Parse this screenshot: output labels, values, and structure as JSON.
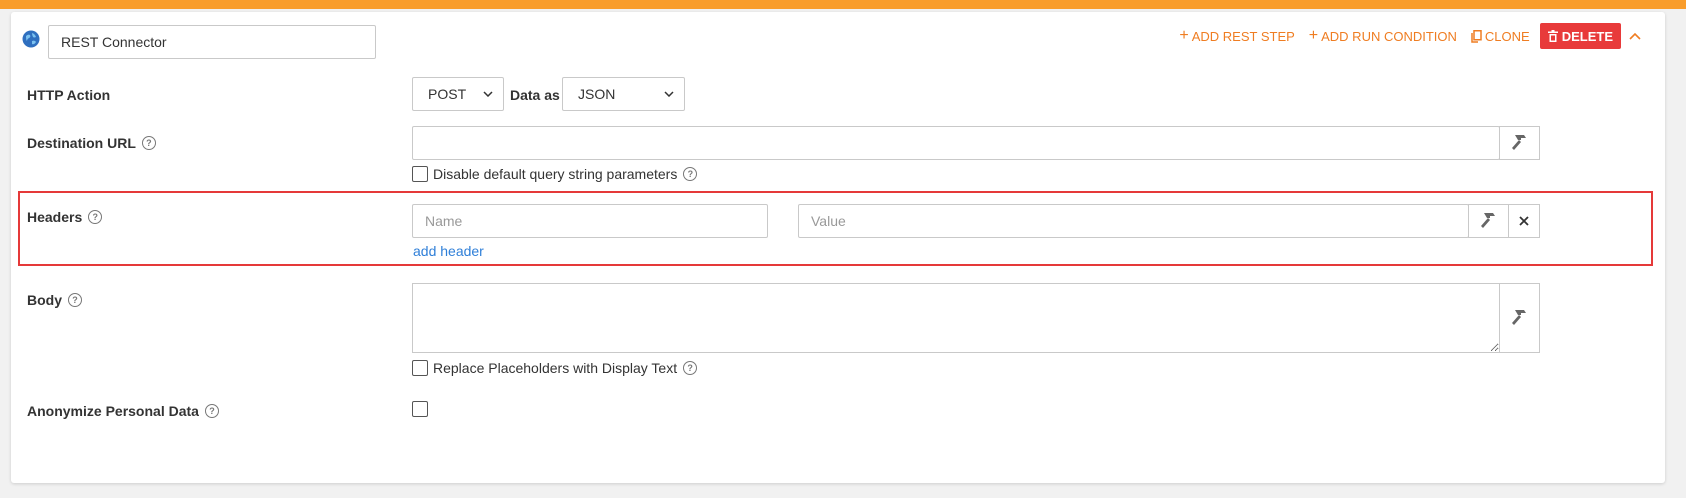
{
  "connector": {
    "name": "REST Connector"
  },
  "toolbar": {
    "add_rest_step": "ADD REST STEP",
    "add_run_condition": "ADD RUN CONDITION",
    "clone": "CLONE",
    "delete": "DELETE"
  },
  "http_action": {
    "label": "HTTP Action",
    "method": "POST",
    "data_as_label": "Data as",
    "data_format": "JSON"
  },
  "destination_url": {
    "label": "Destination URL",
    "value": "",
    "disable_qs_label": "Disable default query string parameters",
    "disable_qs_checked": false
  },
  "headers": {
    "label": "Headers",
    "name_placeholder": "Name",
    "value_placeholder": "Value",
    "add_header": "add header"
  },
  "body": {
    "label": "Body",
    "value": "",
    "replace_placeholders_label": "Replace Placeholders with Display Text",
    "replace_placeholders_checked": false
  },
  "anonymize": {
    "label": "Anonymize Personal Data",
    "checked": false
  },
  "colors": {
    "accent_orange": "#ef7d22",
    "top_bar": "#f99d2b",
    "delete_red": "#e83a3a",
    "link_blue": "#2f7fd8",
    "highlight_red": "#e53939"
  },
  "icons": {
    "globe": "globe-icon",
    "plus": "plus-icon",
    "clone": "copy-icon",
    "delete": "trash-icon",
    "collapse": "chevron-up-icon",
    "help": "question-circle-icon",
    "hammer": "hammer-icon",
    "remove": "close-icon",
    "dropdown": "chevron-down-icon"
  }
}
